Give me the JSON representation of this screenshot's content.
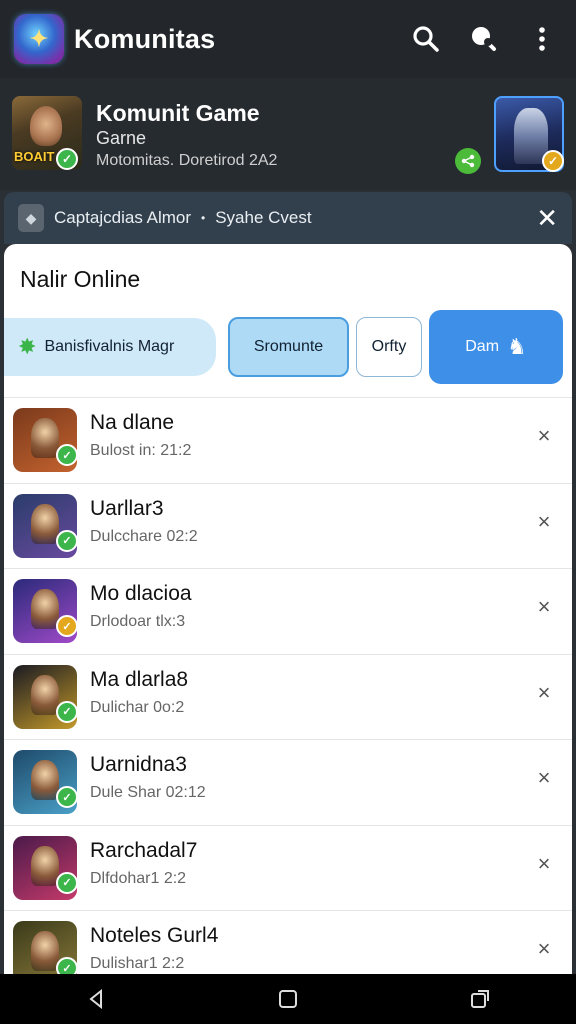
{
  "appbar": {
    "title": "Komunitas",
    "logo_icon": "game-emblem-icon"
  },
  "header": {
    "game_name": "Komunit Game",
    "game_type": "Garne",
    "game_meta": "Motomitas. Doretirod 2A2",
    "thumb_word": "BOAIT"
  },
  "notice": {
    "text_left": "Captajcdias Almor",
    "separator": "•",
    "text_right": "Syahe Cvest",
    "close_label": "✕"
  },
  "panel": {
    "title": "Nalir Online"
  },
  "chips": [
    {
      "label": "Banisfivalnis Magr"
    },
    {
      "label": "Sromunte"
    },
    {
      "label": "Orfty"
    },
    {
      "label": "Dam"
    }
  ],
  "list": [
    {
      "name": "Na dlane",
      "sub": "Bulost in: 21:2",
      "badge": "green",
      "colors": [
        "#7a3a1c",
        "#c4622e"
      ]
    },
    {
      "name": "Uarllar3",
      "sub": "Dulcchare 02:2",
      "badge": "green",
      "colors": [
        "#2a3c6a",
        "#6a4aa0"
      ]
    },
    {
      "name": "Mo dlacioa",
      "sub": "Drlodoar tlx:3",
      "badge": "gold",
      "colors": [
        "#2a2a7a",
        "#a04ac8"
      ]
    },
    {
      "name": "Ma dlarla8",
      "sub": "Dulichar 0o:2",
      "badge": "green",
      "colors": [
        "#1a1a22",
        "#c49a2a"
      ]
    },
    {
      "name": "Uarnidna3",
      "sub": "Dule Shar 02:12",
      "badge": "green",
      "colors": [
        "#1e4a6a",
        "#4aa0c8"
      ]
    },
    {
      "name": "Rarchadal7",
      "sub": "Dlfdohar1 2:2",
      "badge": "green",
      "colors": [
        "#4a1a4a",
        "#c43a6a"
      ]
    },
    {
      "name": "Noteles Gurl4",
      "sub": "Dulishar1 2:2",
      "badge": "green",
      "colors": [
        "#3a3a1a",
        "#8a7a3a"
      ]
    }
  ],
  "colors": {
    "accent": "#3d8fe8",
    "appbar_bg": "#23272b",
    "verified_green": "#3cb54a",
    "verified_gold": "#e4a81e"
  }
}
